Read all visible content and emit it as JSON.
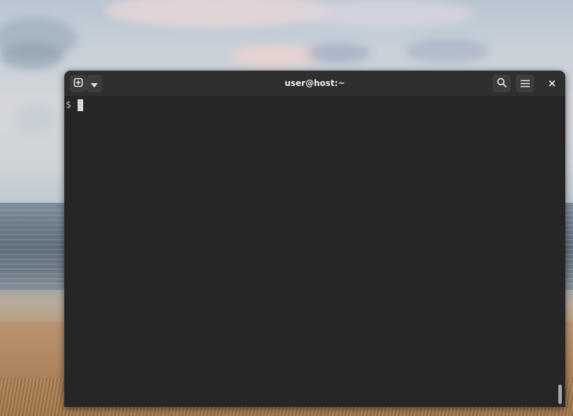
{
  "window": {
    "title": "user@host:~"
  },
  "headerbar": {
    "new_tab_icon": "new-tab-icon",
    "tab_menu_icon": "chevron-down-icon",
    "search_icon": "search-icon",
    "menu_icon": "hamburger-menu-icon",
    "close_icon": "close-icon",
    "close_glyph": "×"
  },
  "terminal": {
    "prompt": "$",
    "lines": []
  },
  "colors": {
    "terminal_bg": "#262626",
    "headerbar_bg": "#2f2f2f",
    "button_bg": "#3d3d3d",
    "text": "#ececec",
    "cursor": "#d7d7d7"
  }
}
